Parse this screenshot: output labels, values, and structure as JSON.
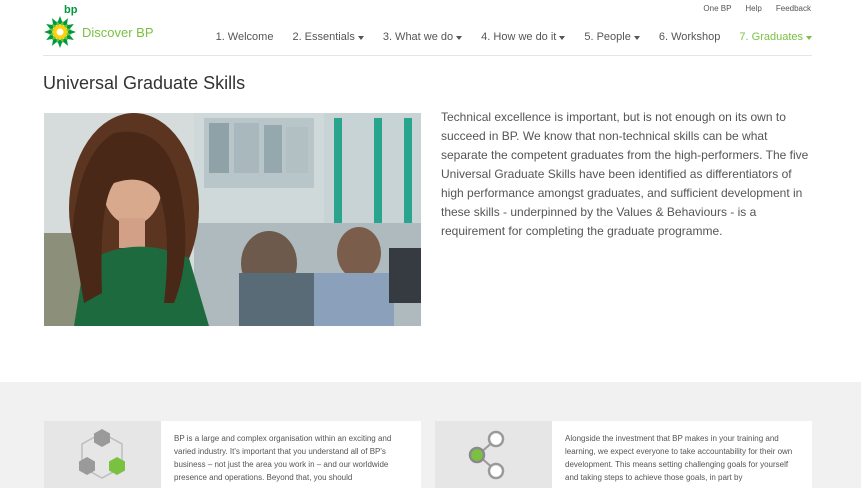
{
  "top_links": [
    "One BP",
    "Help",
    "Feedback"
  ],
  "brand": {
    "mark": "bp",
    "title": "Discover BP",
    "green": "#7ac142",
    "dark_green": "#009a3d",
    "yellow": "#ffd200"
  },
  "nav": [
    {
      "label": "1. Welcome",
      "dropdown": false,
      "active": false
    },
    {
      "label": "2. Essentials",
      "dropdown": true,
      "active": false
    },
    {
      "label": "3. What we do",
      "dropdown": true,
      "active": false
    },
    {
      "label": "4. How we do it",
      "dropdown": true,
      "active": false
    },
    {
      "label": "5. People",
      "dropdown": true,
      "active": false
    },
    {
      "label": "6. Workshop",
      "dropdown": false,
      "active": false
    },
    {
      "label": "7. Graduates",
      "dropdown": true,
      "active": true
    }
  ],
  "page": {
    "title": "Universal Graduate Skills",
    "intro": "Technical excellence is important, but is not enough on its own to succeed in BP. We know that non-technical skills can be what separate the competent graduates from the high-performers. The five Universal Graduate Skills have been identified as differentiators of high performance amongst graduates, and sufficient development in these skills - underpinned by the Values & Behaviours - is a requirement for completing the graduate programme."
  },
  "cards": [
    {
      "icon": "hexagon-cubes-icon",
      "text": "BP is a large and complex organisation within an exciting and varied industry. It's important that you understand all of BP's business – not just the area you work in – and our worldwide presence and operations. Beyond that, you should"
    },
    {
      "icon": "connected-nodes-icon",
      "text": "Alongside the investment that BP makes in your training and learning, we expect everyone to take accountability for their own development. This means setting challenging goals for yourself and taking steps to achieve those goals, in part by"
    }
  ]
}
